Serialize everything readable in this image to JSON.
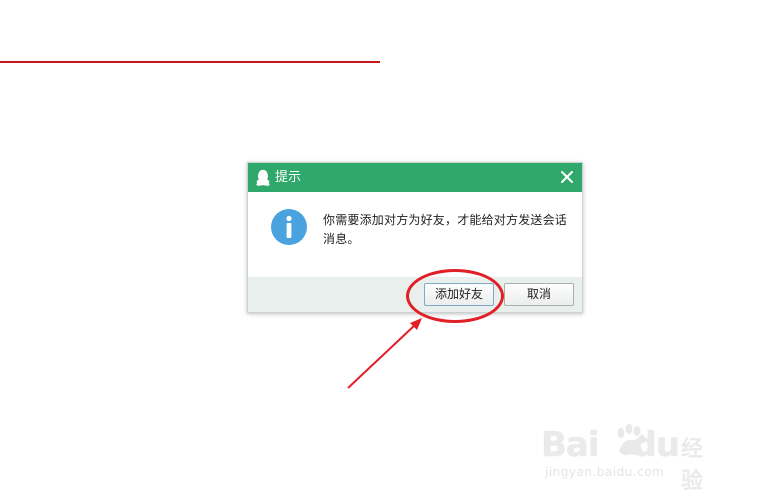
{
  "dialog": {
    "title": "提示",
    "message": "你需要添加对方为好友，才能给对方发送会话消息。",
    "add_friend_label": "添加好友",
    "cancel_label": "取消",
    "icons": {
      "title": "qq-penguin-icon",
      "close": "close-icon",
      "info": "info-icon"
    }
  },
  "watermark": {
    "brand": "Bai",
    "brand_suffix": "du",
    "product": "经验",
    "url": "jingyan.baidu.com"
  },
  "colors": {
    "titlebar": "#2fa86b",
    "footer": "#e8efec",
    "info_circle": "#4aa3df",
    "annotation": "#e21e26",
    "top_rule": "#c9151e"
  }
}
